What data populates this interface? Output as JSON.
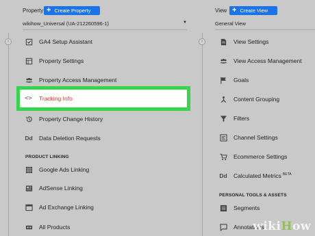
{
  "property": {
    "label": "Property",
    "create_button": "Create Property",
    "selector": "wikihow_Universal (UA-212260596-1)",
    "items": [
      {
        "label": "GA4 Setup Assistant",
        "icon": "checklist-icon"
      },
      {
        "label": "Property Settings",
        "icon": "settings-panel-icon"
      },
      {
        "label": "Property Access Management",
        "icon": "people-icon"
      },
      {
        "label": "Tracking Info",
        "icon": "code-icon"
      },
      {
        "label": "Property Change History",
        "icon": "history-icon"
      },
      {
        "label": "Data Deletion Requests",
        "icon": "dd-icon"
      }
    ],
    "section_product_linking": "PRODUCT LINKING",
    "linking_items": [
      {
        "label": "Google Ads Linking",
        "icon": "ads-grid-icon"
      },
      {
        "label": "AdSense Linking",
        "icon": "adsense-icon"
      },
      {
        "label": "Ad Exchange Linking",
        "icon": "ad-exchange-icon"
      },
      {
        "label": "All Products",
        "icon": "link-icon"
      }
    ]
  },
  "view": {
    "label": "View",
    "create_button": "Create View",
    "selector": "General View",
    "items": [
      {
        "label": "View Settings",
        "icon": "document-icon"
      },
      {
        "label": "View Access Management",
        "icon": "people-icon"
      },
      {
        "label": "Goals",
        "icon": "flag-icon"
      },
      {
        "label": "Content Grouping",
        "icon": "content-grouping-icon"
      },
      {
        "label": "Filters",
        "icon": "filter-icon"
      },
      {
        "label": "Channel Settings",
        "icon": "channel-icon"
      },
      {
        "label": "Ecommerce Settings",
        "icon": "cart-icon"
      },
      {
        "label": "Calculated Metrics",
        "icon": "dd-icon",
        "badge": "BETA"
      }
    ],
    "section_personal": "PERSONAL TOOLS & ASSETS",
    "personal_items": [
      {
        "label": "Segments",
        "icon": "segments-icon"
      },
      {
        "label": "Annotations",
        "icon": "annotation-icon"
      }
    ]
  },
  "watermark": "wikiHow",
  "colors": {
    "accent": "#1a73e8",
    "highlight": "#34d64b",
    "active_text": "#d93025",
    "background": "#c9c9c9"
  }
}
